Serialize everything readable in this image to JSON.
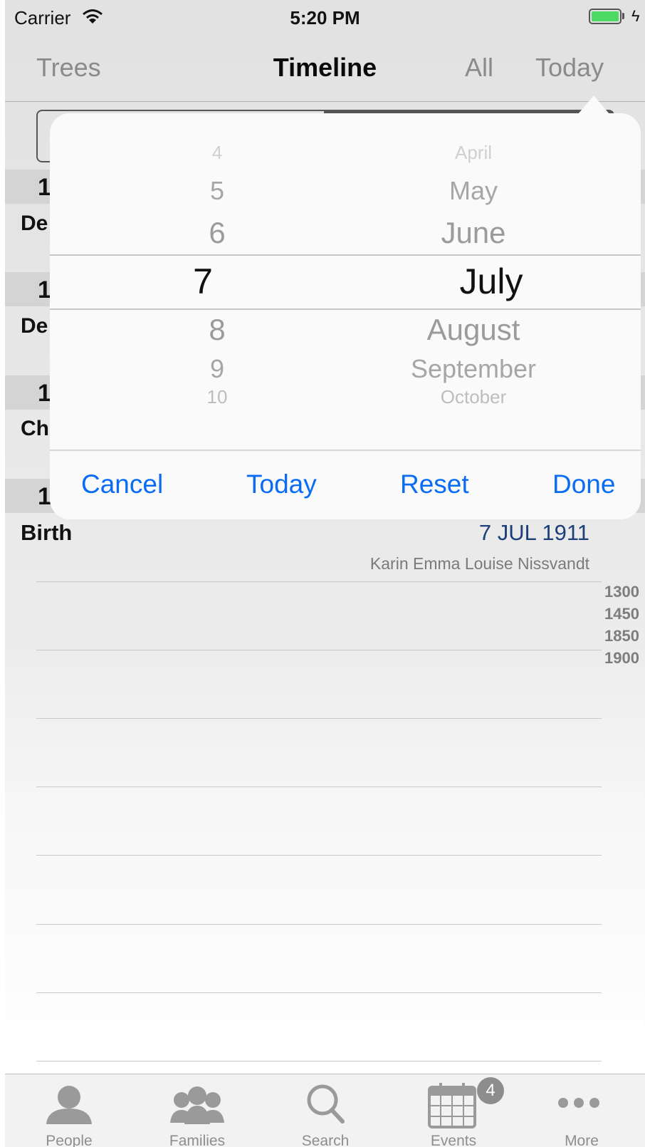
{
  "status_bar": {
    "carrier": "Carrier",
    "time": "5:20 PM"
  },
  "nav": {
    "left": "Trees",
    "title": "Timeline",
    "all": "All",
    "today": "Today"
  },
  "list_stubs": [
    {
      "year": "1",
      "event": "De"
    },
    {
      "year": "1",
      "event": "De"
    },
    {
      "year": "1",
      "event": "Ch"
    },
    {
      "year": "1",
      "event": ""
    }
  ],
  "event": {
    "label": "Birth",
    "date": "7 JUL 1911",
    "person": "Karin Emma Louise Nissvandt"
  },
  "year_index": [
    "1300",
    "1450",
    "1850",
    "1900"
  ],
  "picker": {
    "days": [
      "4",
      "5",
      "6",
      "7",
      "8",
      "9",
      "10"
    ],
    "months": [
      "April",
      "May",
      "June",
      "July",
      "August",
      "September",
      "October"
    ],
    "selected_day": "7",
    "selected_month": "July"
  },
  "actions": {
    "cancel": "Cancel",
    "today": "Today",
    "reset": "Reset",
    "done": "Done"
  },
  "tabbar": {
    "tabs": [
      {
        "label": "People",
        "icon": "person-icon"
      },
      {
        "label": "Families",
        "icon": "group-icon"
      },
      {
        "label": "Search",
        "icon": "search-icon"
      },
      {
        "label": "Events",
        "icon": "calendar-icon"
      },
      {
        "label": "More",
        "icon": "more-icon"
      }
    ],
    "events_badge": "4"
  },
  "colors": {
    "accent": "#0a6cf5",
    "date_text": "#1d3f7a",
    "battery": "#4cd964"
  }
}
